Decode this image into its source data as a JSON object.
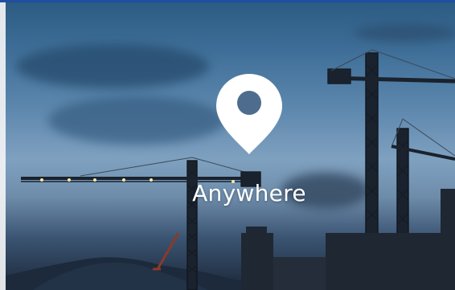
{
  "hero": {
    "caption": "Anywhere",
    "icon": "location-pin-icon"
  },
  "colors": {
    "sky_top": "#2b5a82",
    "sky_mid": "#7fa1c0",
    "ground": "#1b2838",
    "accent_bar": "#1f4fa0",
    "caption": "#ffffff"
  }
}
